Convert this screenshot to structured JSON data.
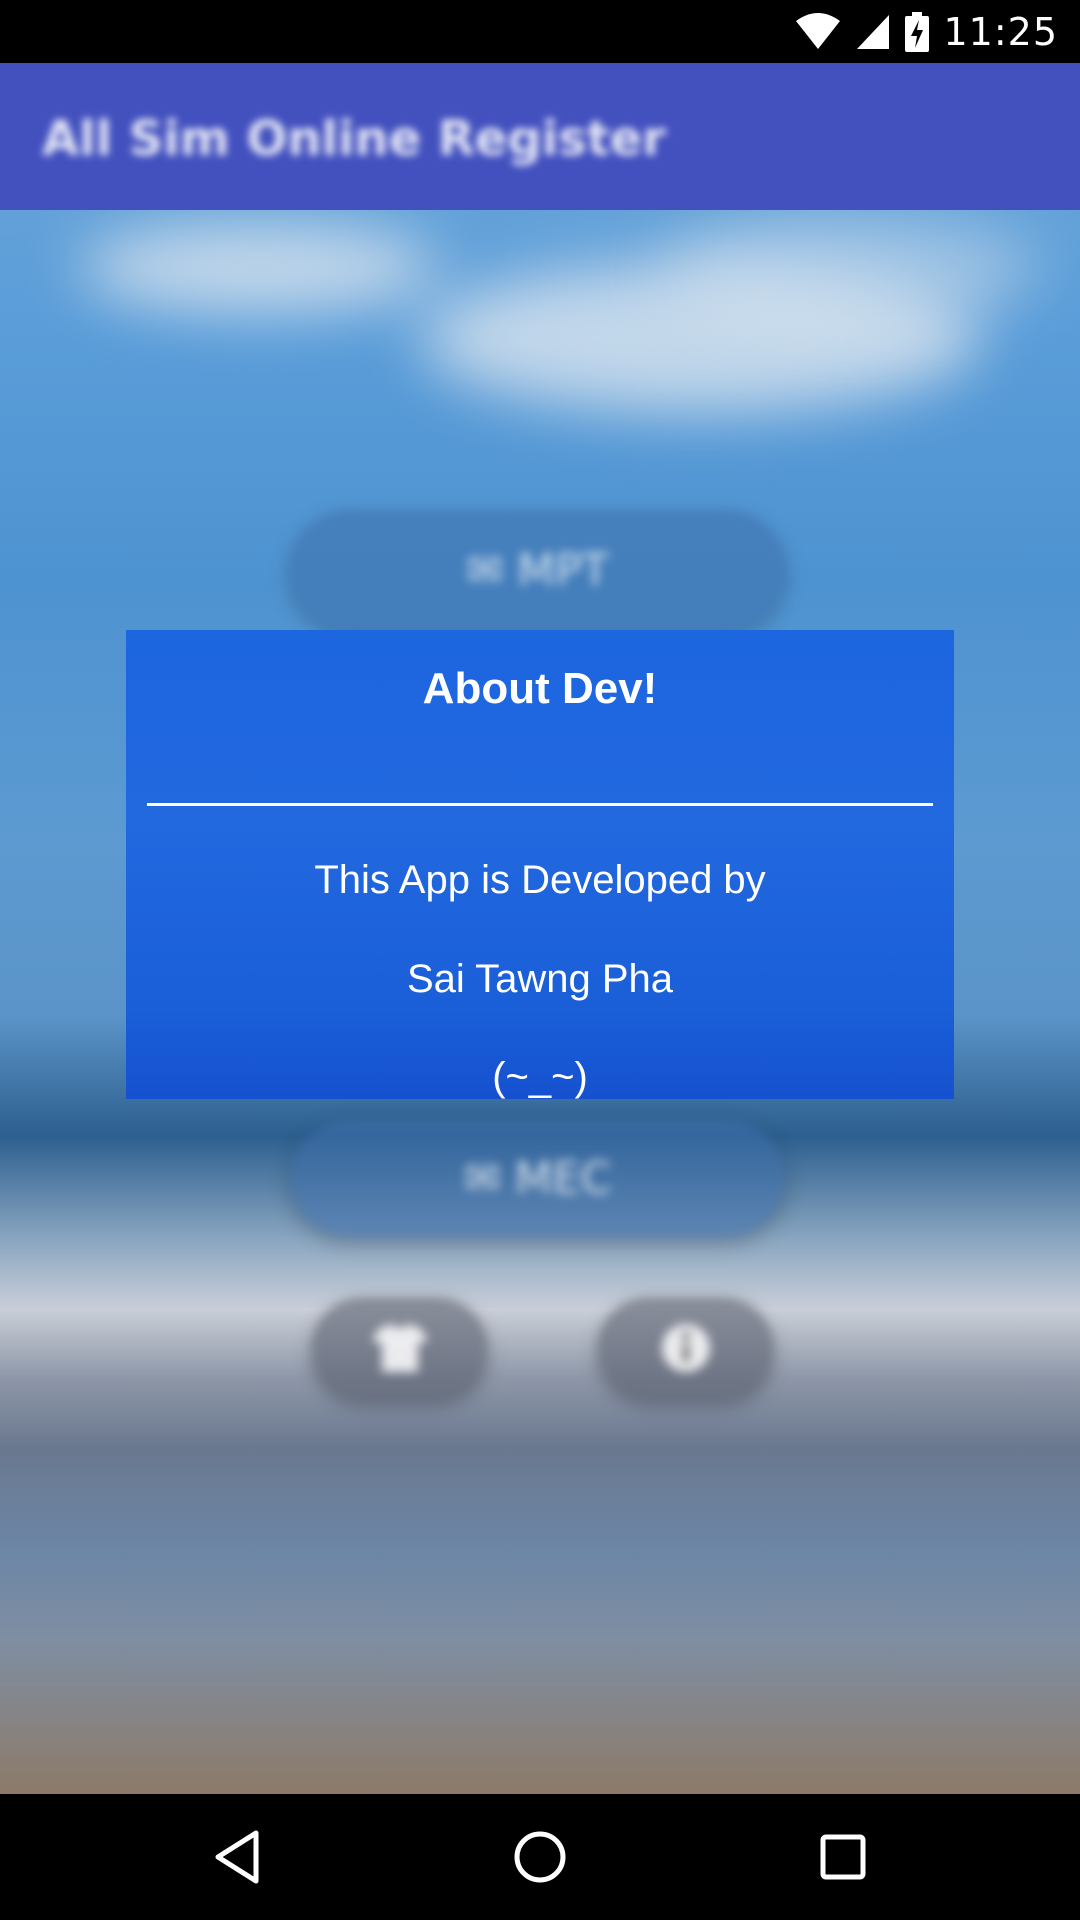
{
  "status_bar": {
    "time": "11:25",
    "icons": [
      "wifi-icon",
      "cell-signal-icon",
      "battery-charging-icon"
    ]
  },
  "app_bar": {
    "title": "All Sim Online Register",
    "color": "#4351bf"
  },
  "background_buttons": {
    "mpt_label": "✉ MPT",
    "mec_label": "✉ MEC"
  },
  "dialog": {
    "title": "About Dev!",
    "line1": "This App is Developed by",
    "line2": "Sai Tawng Pha",
    "line3": "(~_~)",
    "color": "#1f65df"
  },
  "nav_bar": {
    "icons": [
      "back-icon",
      "home-icon",
      "recents-icon"
    ]
  }
}
